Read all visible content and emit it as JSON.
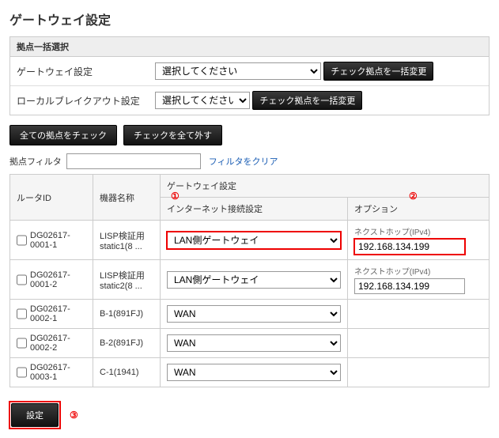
{
  "page": {
    "title": "ゲートウェイ設定"
  },
  "batch": {
    "header": "拠点一括選択",
    "rows": {
      "gateway": {
        "label": "ゲートウェイ設定",
        "placeholder": "選択してください",
        "button": "チェック拠点を一括変更"
      },
      "breakout": {
        "label": "ローカルブレイクアウト設定",
        "placeholder": "選択してください",
        "button": "チェック拠点を一括変更"
      }
    }
  },
  "buttons": {
    "check_all": "全ての拠点をチェック",
    "uncheck_all": "チェックを全て外す",
    "apply": "設定"
  },
  "filter": {
    "label": "拠点フィルタ",
    "clear": "フィルタをクリア"
  },
  "table": {
    "headers": {
      "router": "ルータID",
      "device": "機器名称",
      "group": "ゲートウェイ設定",
      "conn": "インターネット接続設定",
      "option": "オプション"
    },
    "option_sublabel": "ネクストホップ(IPv4)",
    "rows": [
      {
        "router": "DG02617-0001-1",
        "device": "LISP検証用 static1(8 ...",
        "conn": "LAN側ゲートウェイ",
        "opt": "192.168.134.199",
        "highlight": true
      },
      {
        "router": "DG02617-0001-2",
        "device": "LISP検証用 static2(8 ...",
        "conn": "LAN側ゲートウェイ",
        "opt": "192.168.134.199",
        "highlight": false
      },
      {
        "router": "DG02617-0002-1",
        "device": "B-1(891FJ)",
        "conn": "WAN",
        "opt": "",
        "highlight": false
      },
      {
        "router": "DG02617-0002-2",
        "device": "B-2(891FJ)",
        "conn": "WAN",
        "opt": "",
        "highlight": false
      },
      {
        "router": "DG02617-0003-1",
        "device": "C-1(1941)",
        "conn": "WAN",
        "opt": "",
        "highlight": false
      }
    ]
  },
  "annotation": {
    "one": "①",
    "two": "②",
    "three": "③"
  }
}
